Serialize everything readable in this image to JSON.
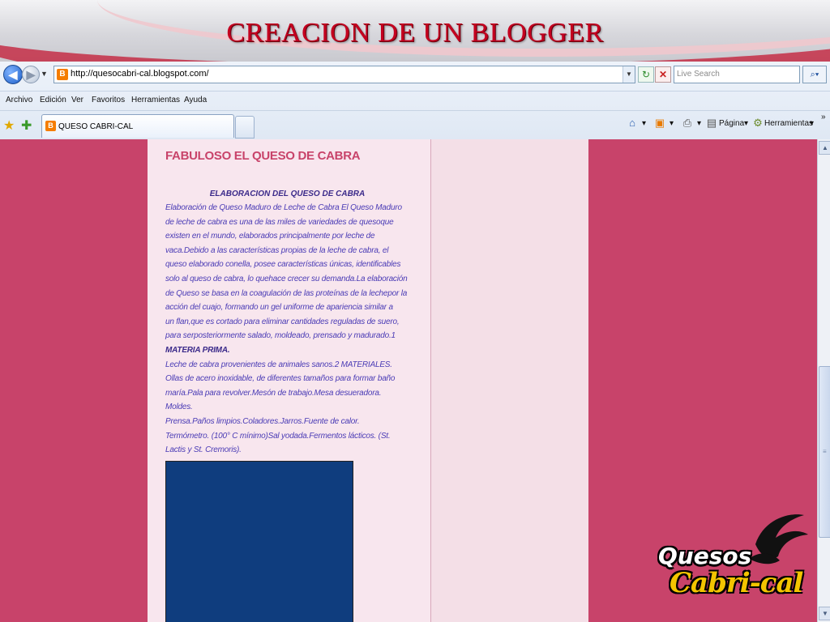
{
  "slide": {
    "title": "CREACION DE UN BLOGGER"
  },
  "browser": {
    "address": {
      "url": "http://quesocabri-cal.blogspot.com/"
    },
    "search": {
      "placeholder": "Live Search"
    },
    "menu": [
      "Archivo",
      "Edición",
      "Ver",
      "Favoritos",
      "Herramientas",
      "Ayuda"
    ],
    "tab": {
      "title": "QUESO CABRI-CAL"
    },
    "command_bar": {
      "page": "Página",
      "tools": "Herramientas"
    },
    "icons": [
      "back-icon",
      "forward-icon",
      "refresh-icon",
      "stop-icon",
      "search-icon",
      "favorites-star-icon",
      "add-favorite-icon",
      "home-icon",
      "rss-feed-icon",
      "print-icon",
      "page-icon",
      "tools-icon",
      "chevron-more-icon"
    ]
  },
  "blog": {
    "post_title": "FABULOSO EL QUESO DE CABRA",
    "subtitle": "ELABORACION DEL QUESO DE CABRA",
    "lines": [
      "Elaboración de Queso Maduro de Leche de Cabra El Queso Maduro",
      "de  leche  de  cabra es una  de  las miles de variedades de quesoque",
      "existen   en   el   mundo,   elaborados principalmente por leche de",
      "vaca.Debido  a  las  características propias de la leche de cabra, el",
      "queso  elaborado conella, posee características únicas, identificables",
      "solo al queso de cabra, lo quehace crecer su demanda.La elaboración",
      "de Queso se basa en la coagulación de las proteínas de la lechepor la",
      "acción del  cuajo, formando un gel uniforme de apariencia similar a",
      "un  flan,que es cortado para eliminar cantidades reguladas de suero,",
      "para serposteriormente salado, moldeado, prensado y madurado.1"
    ],
    "materia_prima": "MATERIA PRIMA.",
    "bullet_lines": [
      " Leche de cabra provenientes de animales sanos.2 MATERIALES.",
      "Ollas de acero  inoxidable, de diferentes tamaños para formar baño",
      "maría.Pala para revolver.Mesón de trabajo.Mesa desueradora.",
      "Moldes.",
      " Prensa.Paños limpios.Coladores.Jarros.Fuente de calor.",
      "Termómetro. (100° C  mínimo)Sal yodada.Fermentos lácticos. (St.",
      "Lactis y St. Cremoris)."
    ],
    "bullet_mark": "",
    "colors": {
      "background": "#c8436a",
      "post_bg": "#f8e6ee",
      "text": "#4a3bb5",
      "image_block": "#0f3d7e"
    }
  },
  "logo": {
    "line1": "Quesos",
    "line2": "Cabri-cal"
  }
}
